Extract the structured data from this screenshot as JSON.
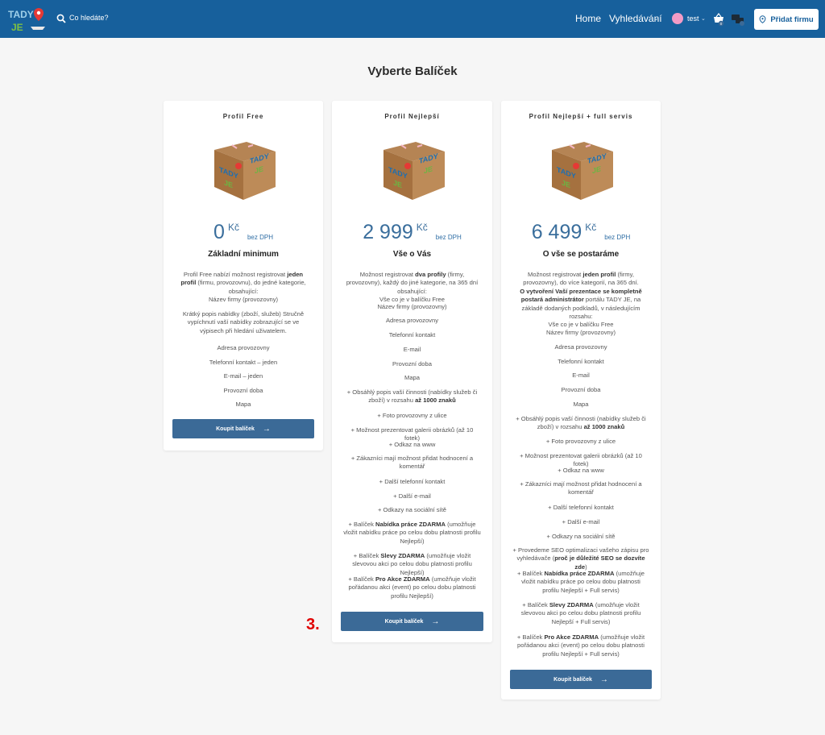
{
  "header": {
    "logo_text_top": "TADY",
    "logo_text_bottom": "JE",
    "search_label": "Co hledáte?",
    "nav_home": "Home",
    "nav_search": "Vyhledávání",
    "user_name": "test",
    "basket_count": "0",
    "add_button_label": "Přidat firmu",
    "colors": {
      "header_bg": "#17609c",
      "button_bg": "#3b6a97",
      "price": "#3a6e9c",
      "annotation": "#e00000"
    }
  },
  "page_title": "Vyberte Balíček",
  "annotation": "3.",
  "buy_label": "Koupit balíček",
  "cards": [
    {
      "title": "Profil Free",
      "price": "0",
      "currency": "Kč",
      "vat": "bez DPH",
      "subtitle": "Základní minimum",
      "intro_a": "Profil Free nabízí možnost registrovat ",
      "intro_b": "jeden profil",
      "intro_c": " (firmu, provozovnu), do jedné kategorie, obsahující:",
      "intro_d": "Název firmy (provozovny)",
      "features": [
        "Krátký popis nabídky (zboží, služeb) Stručně vypíchnutí vaší nabídky zobrazující se ve výpisech při hledání uživatelem.",
        "Adresa provozovny",
        "Telefonní kontakt – jeden",
        "E-mail – jeden",
        "Provozní doba",
        "Mapa"
      ]
    },
    {
      "title": "Profil Nejlepší",
      "price": "2 999",
      "currency": "Kč",
      "vat": "bez DPH",
      "subtitle": "Vše o Vás",
      "intro_a": "Možnost registrovat ",
      "intro_b": "dva profily",
      "intro_c": " (firmy, provozovny), každý do jiné kategorie, na 365 dní obsahující:",
      "intro_d": "Vše co je v balíčku Free",
      "features": [
        "Název firmy (provozovny)",
        "Adresa provozovny",
        "Telefonní kontakt",
        "E-mail",
        "Provozní doba",
        "Mapa",
        {
          "a": "+ Obsáhlý popis vaší činnosti (nabídky služeb či zboží) v rozsahu ",
          "b": "až 1000 znaků",
          "c": ""
        },
        "+ Foto provozovny z ulice",
        "+ Možnost prezentovat galerii obrázků (až 10 fotek)",
        "+ Odkaz na www",
        "+ Zákazníci mají možnost přidat hodnocení a komentář",
        "+ Další telefonní kontakt",
        "+ Další e-mail",
        "+ Odkazy na sociální sítě",
        {
          "a": "+ Balíček ",
          "b": "Nabídka práce ZDARMA",
          "c": " (umožňuje vložit nabídku práce po celou dobu platnosti profilu Nejlepší)"
        },
        {
          "a": "+ Balíček ",
          "b": "Slevy ZDARMA",
          "c": " (umožňuje vložit slevovou akci po celou dobu platnosti profilu Nejlepší)"
        },
        {
          "a": "+ Balíček ",
          "b": "Pro Akce ZDARMA",
          "c": " (umožňuje vložit pořádanou akci (event) po celou dobu platnosti profilu Nejlepší)"
        }
      ]
    },
    {
      "title": "Profil Nejlepší + full servis",
      "price": "6 499",
      "currency": "Kč",
      "vat": "bez DPH",
      "subtitle": "O vše se postaráme",
      "intro_a": "Možnost registrovat ",
      "intro_b": "jeden profil",
      "intro_c": " (firmy, provozovny), do více kategorií, na 365 dní.",
      "intro_e1": "O vytvoření Vaší prezentace se kompletně postará administrátor",
      "intro_e2": " portálu TADY JE, na základě dodaných podkladů, v následujícím rozsahu:",
      "intro_d": "Vše co je v balíčku Free",
      "features": [
        "Název firmy (provozovny)",
        "Adresa provozovny",
        "Telefonní kontakt",
        "E-mail",
        "Provozní doba",
        "Mapa",
        {
          "a": "+ Obsáhlý popis vaší činnosti (nabídky služeb či zboží) v rozsahu ",
          "b": "až 1000 znaků",
          "c": ""
        },
        "+ Foto provozovny z ulice",
        "+ Možnost prezentovat galerii obrázků (až 10 fotek)",
        "+ Odkaz na www",
        "+ Zákazníci mají možnost přidat hodnocení a komentář",
        "+ Další telefonní kontakt",
        "+ Další e-mail",
        "+ Odkazy na sociální sítě",
        {
          "a": "+ Provedeme SEO optimalizaci vašeho zápisu pro vyhledávače (",
          "b": "proč je důležité SEO se dozvíte zde",
          "c": ")"
        },
        {
          "a": "+ Balíček ",
          "b": "Nabídka práce ZDARMA",
          "c": " (umožňuje vložit nabídku práce po celou dobu platnosti profilu Nejlepší + Full servis)"
        },
        {
          "a": "+ Balíček ",
          "b": "Slevy ZDARMA",
          "c": " (umožňuje vložit slevovou akci po celou dobu platnosti profilu Nejlepší + Full servis)"
        },
        {
          "a": "+ Balíček ",
          "b": "Pro Akce ZDARMA",
          "c": " (umožňuje vložit pořádanou akci (event) po celou dobu platnosti profilu Nejlepší + Full servis)"
        }
      ]
    }
  ]
}
